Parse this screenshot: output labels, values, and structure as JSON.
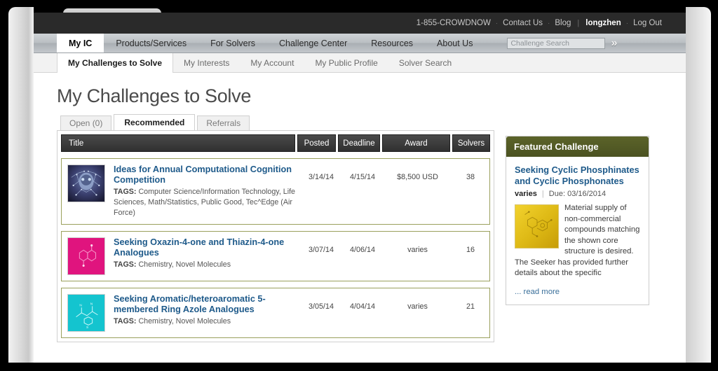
{
  "utilbar": {
    "phone": "1-855-CROWDNOW",
    "contact": "Contact Us",
    "blog": "Blog",
    "user": "longzhen",
    "logout": "Log Out",
    "sep": "·",
    "pipe": "|"
  },
  "mainnav": {
    "items": [
      {
        "label": "My IC",
        "active": true
      },
      {
        "label": "Products/Services",
        "active": false
      },
      {
        "label": "For Solvers",
        "active": false
      },
      {
        "label": "Challenge Center",
        "active": false
      },
      {
        "label": "Resources",
        "active": false
      },
      {
        "label": "About Us",
        "active": false
      }
    ],
    "search_placeholder": "Challenge Search",
    "search_value": "",
    "go_label": "»"
  },
  "subnav": {
    "items": [
      {
        "label": "My Challenges to Solve",
        "active": true
      },
      {
        "label": "My Interests",
        "active": false
      },
      {
        "label": "My Account",
        "active": false
      },
      {
        "label": "My Public Profile",
        "active": false
      },
      {
        "label": "Solver Search",
        "active": false
      }
    ]
  },
  "page": {
    "title": "My Challenges to Solve"
  },
  "tabs": [
    {
      "label": "Open (0)",
      "active": false
    },
    {
      "label": "Recommended",
      "active": true
    },
    {
      "label": "Referrals",
      "active": false
    }
  ],
  "table": {
    "columns": {
      "title": "Title",
      "posted": "Posted",
      "deadline": "Deadline",
      "award": "Award",
      "solvers": "Solvers"
    },
    "tags_label": "TAGS:",
    "rows": [
      {
        "title": "Ideas for Annual Computational Cognition Competition",
        "tags": "Computer Science/Information Technology, Life Sciences, Math/Statistics, Public Good, Tec^Edge (Air Force)",
        "posted": "3/14/14",
        "deadline": "4/15/14",
        "award": "$8,500 USD",
        "solvers": "38",
        "thumb": "brain-network-thumbnail"
      },
      {
        "title": "Seeking Oxazin-4-one and Thiazin-4-one Analogues",
        "tags": "Chemistry, Novel Molecules",
        "posted": "3/07/14",
        "deadline": "4/06/14",
        "award": "varies",
        "solvers": "16",
        "thumb": "pink-molecule-thumbnail"
      },
      {
        "title": "Seeking Aromatic/heteroaromatic 5-membered Ring Azole Analogues",
        "tags": "Chemistry, Novel Molecules",
        "posted": "3/05/14",
        "deadline": "4/04/14",
        "award": "varies",
        "solvers": "21",
        "thumb": "teal-molecule-thumbnail"
      }
    ]
  },
  "featured": {
    "heading": "Featured Challenge",
    "title": "Seeking Cyclic Phosphinates and Cyclic Phosphonates",
    "award": "varies",
    "due_label": "Due: 03/16/2014",
    "separator": "|",
    "description": "Material supply of non-commercial compounds matching the shown core structure is desired.   The Seeker has provided further details about the specific",
    "read_more": "... read more",
    "image": "gold-molecule-thumbnail"
  },
  "colors": {
    "accent_link": "#1e5a8a",
    "featured_header": "#4b5221",
    "row_border": "#9aa05c",
    "table_header": "#303030",
    "utilbar": "#2a2a2a"
  }
}
